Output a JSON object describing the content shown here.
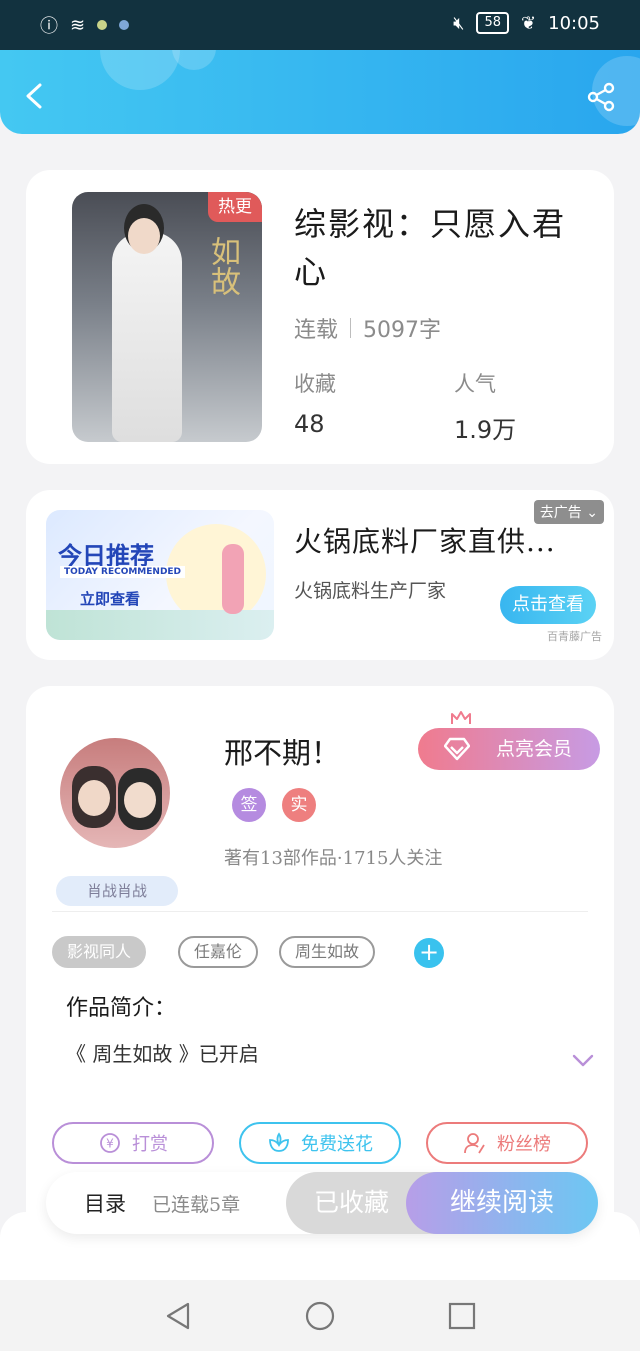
{
  "status_bar": {
    "battery": "58",
    "time": "10:05"
  },
  "book": {
    "hot_badge": "热更",
    "cover_art_text": "如故",
    "title": "综影视：只愿入君心",
    "status": "连载",
    "word_count": "5097字",
    "favorites_label": "收藏",
    "favorites_value": "48",
    "popularity_label": "人气",
    "popularity_value": "1.9万"
  },
  "ad": {
    "image_title": "今日推荐",
    "image_subtitle": "TODAY RECOMMENDED",
    "image_cta": "立即查看",
    "title": "火锅底料厂家直供...",
    "description": "火锅底料生产厂家",
    "tag": "去广告",
    "cta": "点击查看",
    "source": "百青藤广告"
  },
  "author": {
    "name": "邢不期！",
    "vip_button": "点亮会员",
    "badge_sign": "签",
    "badge_real": "实",
    "meta": "著有13部作品·1715人关注",
    "fan_tag": "肖战肖战"
  },
  "tags": [
    "影视同人",
    "任嘉伦",
    "周生如故"
  ],
  "intro": {
    "title": "作品简介：",
    "text": "《 周生如故 》已开启"
  },
  "actions": {
    "reward": "打赏",
    "flower": "免费送花",
    "fans": "粉丝榜"
  },
  "bottom_bar": {
    "catalog": "目录",
    "chapters": "已连载5章",
    "collected": "已收藏",
    "continue": "继续阅读"
  },
  "colors": {
    "accent_blue": "#29a6ee",
    "hot_red": "#e05a5a",
    "vip_pink": "#f07b8e",
    "reward_purple": "#b98fd8",
    "flower_cyan": "#3ec3ee",
    "fans_red": "#ec7b7b"
  }
}
